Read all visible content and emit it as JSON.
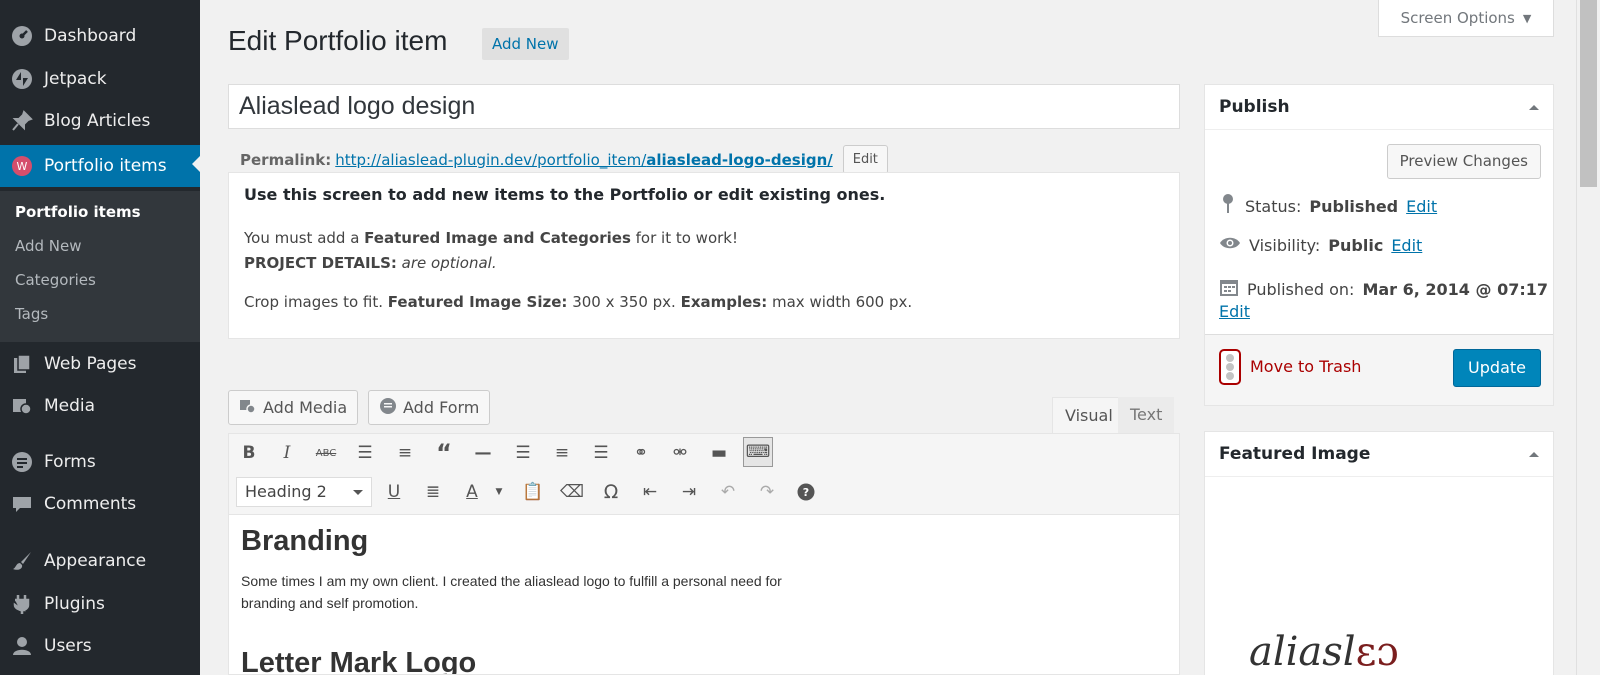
{
  "sidebar": {
    "menu": [
      {
        "label": "Dashboard",
        "icon": "dashboard-icon"
      },
      {
        "label": "Jetpack",
        "icon": "jetpack-icon"
      },
      {
        "label": "Blog Articles",
        "icon": "pin-icon"
      },
      {
        "label": "Portfolio items",
        "icon": "portfolio-icon"
      },
      {
        "label": "Web Pages",
        "icon": "pages-icon"
      },
      {
        "label": "Media",
        "icon": "media-icon"
      },
      {
        "label": "Forms",
        "icon": "forms-icon"
      },
      {
        "label": "Comments",
        "icon": "comments-icon"
      },
      {
        "label": "Appearance",
        "icon": "brush-icon"
      },
      {
        "label": "Plugins",
        "icon": "plugin-icon"
      },
      {
        "label": "Users",
        "icon": "users-icon"
      }
    ],
    "submenu": [
      "Portfolio items",
      "Add New",
      "Categories",
      "Tags"
    ],
    "active_color": "#0073aa"
  },
  "header": {
    "title": "Edit Portfolio item",
    "add_new": "Add New",
    "screen_options": "Screen Options"
  },
  "post": {
    "title": "Aliaslead logo design",
    "permalink_label": "Permalink:",
    "permalink_base": "http://aliaslead-plugin.dev/portfolio_item/",
    "permalink_slug": "aliaslead-logo-design/",
    "permalink_edit": "Edit"
  },
  "help": {
    "heading": "Use this screen to add new items to the Portfolio or edit existing ones.",
    "l1a": "You must add a ",
    "l1b": "Featured Image and Categories",
    "l1c": " for it to work!",
    "l2a": "PROJECT DETAILS:",
    "l2b": " are optional.",
    "l3a": "Crop images to fit. ",
    "l3b": "Featured Image Size:",
    "l3c": " 300 x 350 px. ",
    "l3d": "Examples:",
    "l3e": " max width 600 px."
  },
  "editor": {
    "add_media": "Add Media",
    "add_form": "Add Form",
    "tab_visual": "Visual",
    "tab_text": "Text",
    "format": "Heading 2",
    "h1": "Branding",
    "p1": "Some times I am my own client. I created the aliaslead logo to fulfill  a personal need for branding and self promotion.",
    "h2": "Letter Mark Logo"
  },
  "publish": {
    "title": "Publish",
    "preview": "Preview Changes",
    "status_label": "Status:",
    "status_value": "Published",
    "visibility_label": "Visibility:",
    "visibility_value": "Public",
    "published_label": "Published on:",
    "published_value": "Mar 6, 2014 @ 07:17",
    "edit": "Edit",
    "trash": "Move to Trash",
    "update": "Update"
  },
  "featured": {
    "title": "Featured Image",
    "logo_text": "aliasl"
  }
}
